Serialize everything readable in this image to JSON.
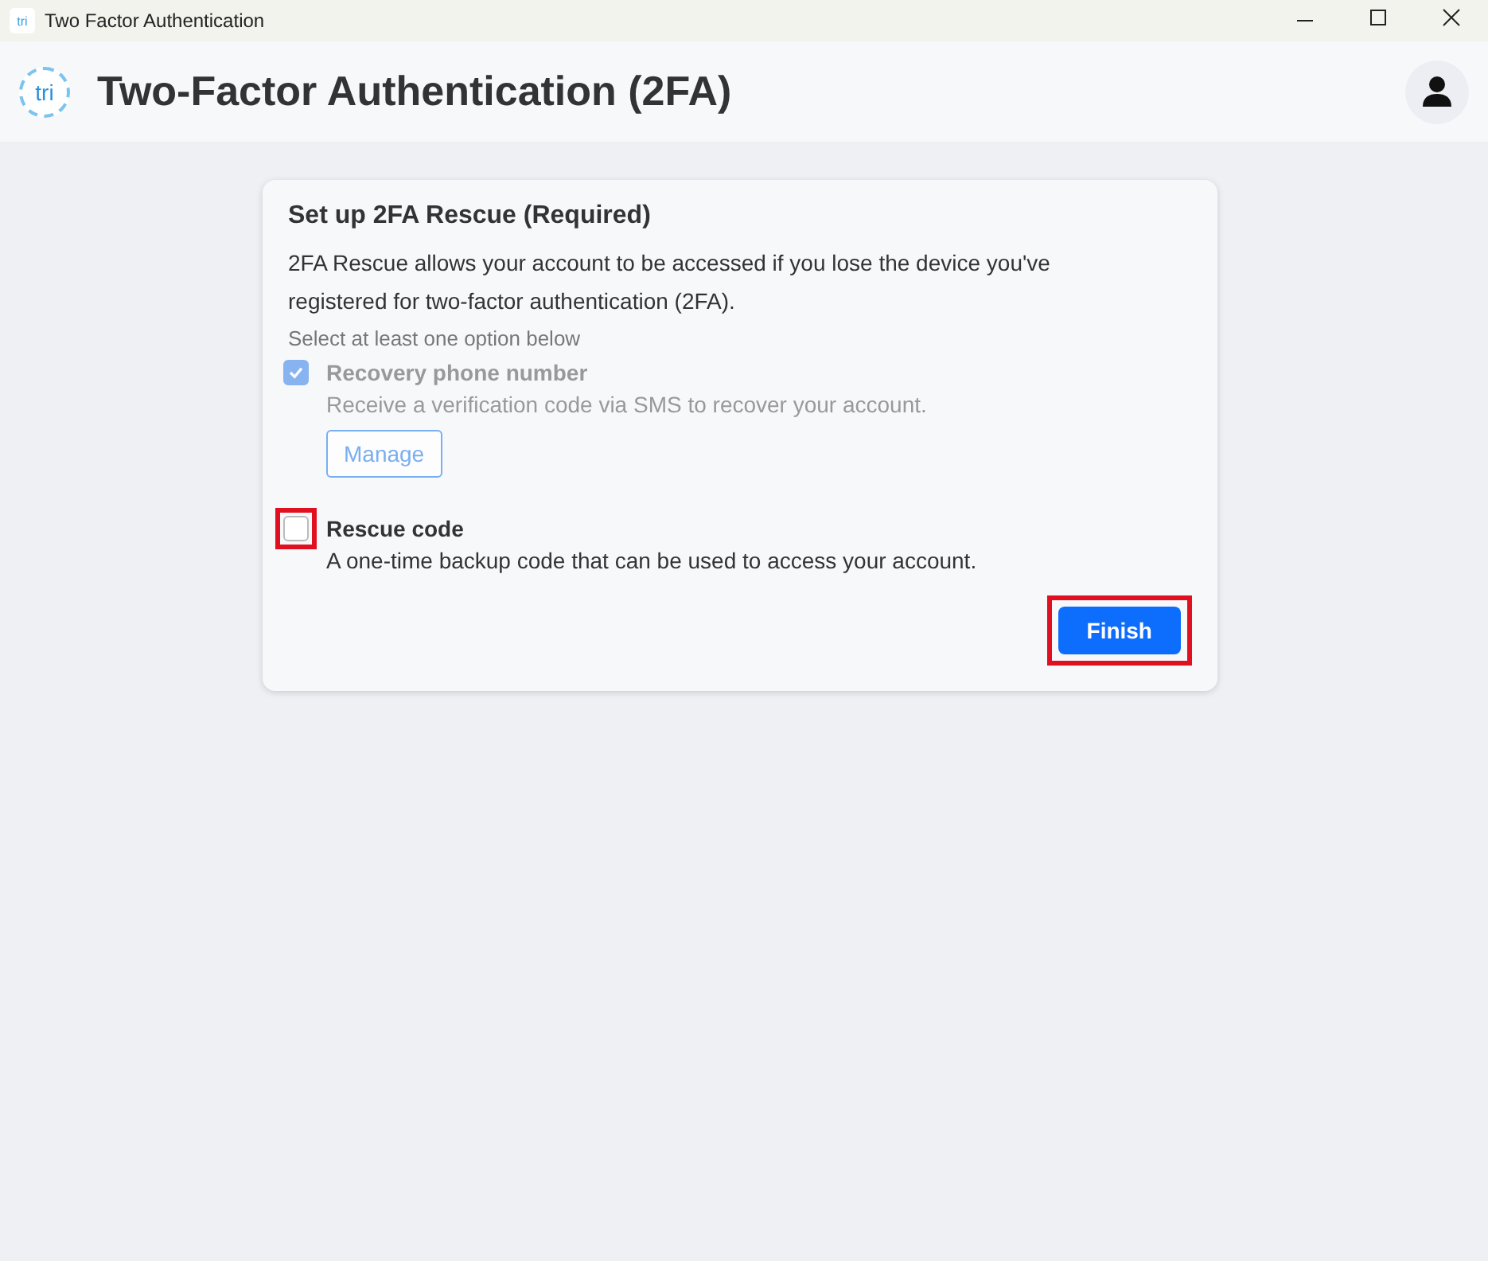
{
  "window": {
    "title": "Two Factor Authentication",
    "logo": "tri"
  },
  "header": {
    "logo": "tri",
    "title": "Two-Factor Authentication (2FA)"
  },
  "card": {
    "title": "Set up 2FA Rescue (Required)",
    "description": "2FA Rescue allows your account to be accessed if you lose the device you've registered for two-factor authentication (2FA).",
    "hint": "Select at least one option below",
    "options": [
      {
        "label": "Recovery phone number",
        "description": "Receive a verification code via SMS to recover your account.",
        "checked": true,
        "disabled": true,
        "highlighted": false,
        "button": "Manage"
      },
      {
        "label": "Rescue code",
        "description": "A one-time backup code that can be used to access your account.",
        "checked": false,
        "disabled": false,
        "highlighted": true
      }
    ],
    "finish": {
      "label": "Finish",
      "highlighted": true
    }
  }
}
